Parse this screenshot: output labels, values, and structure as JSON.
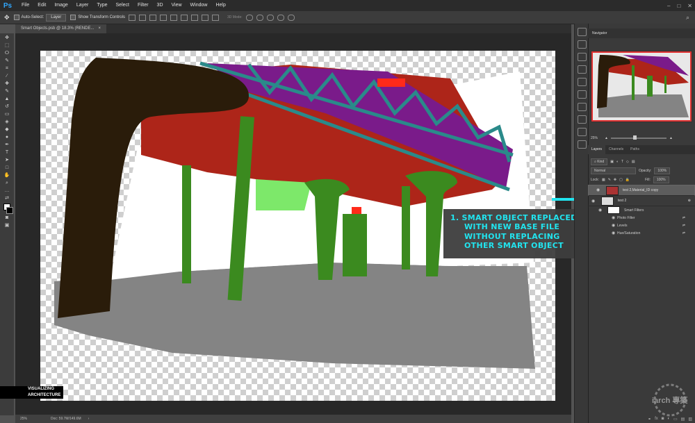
{
  "app": {
    "logo": "Ps",
    "menu": [
      "File",
      "Edit",
      "Image",
      "Layer",
      "Type",
      "Select",
      "Filter",
      "3D",
      "View",
      "Window",
      "Help"
    ],
    "window_controls": [
      "–",
      "□",
      "✕"
    ]
  },
  "options": {
    "auto_select": "Auto-Select:",
    "layer_select": "Layer",
    "show_transform": "Show Transform Controls",
    "mode3d": "3D Mode:"
  },
  "document": {
    "tab_title": "Smart Objects.psb @ 18.3% (RENDE...",
    "close": "×"
  },
  "watermark": {
    "line1": "VISUALIZING",
    "line2": "ARCHITECTURE",
    "site": "iarch 專築"
  },
  "annotation": {
    "lines": [
      "1.  SMART OBJECT REPLACED",
      "WITH NEW BASE FILE",
      "WITHOUT REPLACING",
      "OTHER SMART OBJECT"
    ]
  },
  "status": {
    "zoom": "25%",
    "doc": "Doc: 59.7M/149.6M"
  },
  "navigator": {
    "title": "Navigator",
    "zoom": "25%"
  },
  "layers": {
    "tabs": [
      "Layers",
      "Channels",
      "Paths"
    ],
    "kind": "Kind",
    "blend": "Normal",
    "opacity_label": "Opacity:",
    "opacity": "100%",
    "lock_label": "Lock:",
    "fill_label": "Fill:",
    "fill": "100%",
    "items": [
      {
        "name": "test 2,Material_ID copy"
      },
      {
        "name": "test 2"
      }
    ],
    "filters_title": "Smart Filters",
    "filters": [
      "Photo Filter",
      "Levels",
      "Hue/Saturation"
    ]
  },
  "colors": {
    "accent": "#21e4ef",
    "brace": "#8e2a2a",
    "deck": "#ad2519",
    "truss": "#2a8a8a",
    "roof": "#7a1b8a",
    "column": "#3b8a1f",
    "ground": "#848484"
  }
}
